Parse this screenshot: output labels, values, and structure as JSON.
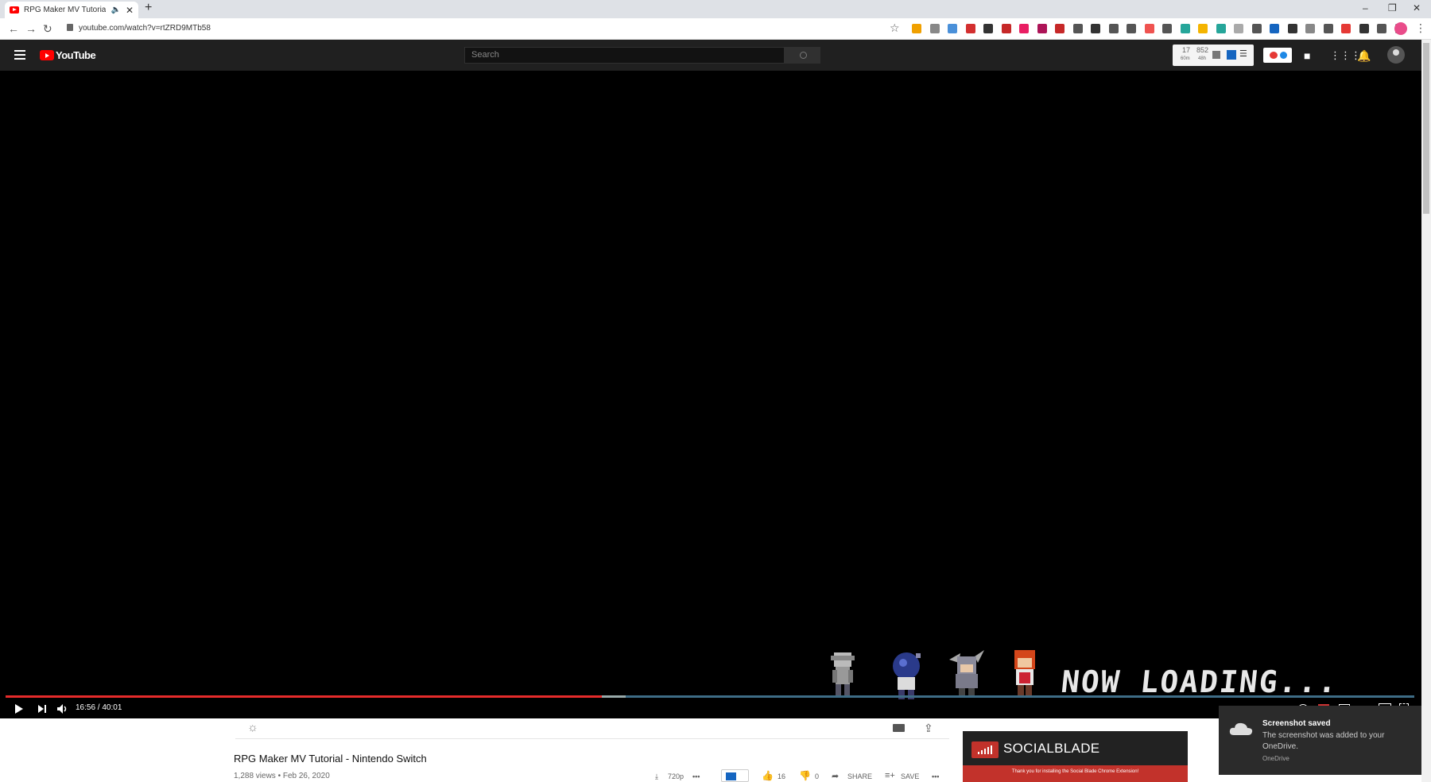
{
  "browser": {
    "tab_title": "RPG Maker MV Tutorial - Ni",
    "url": "youtube.com/watch?v=rtZRD9MTb58",
    "extension_colors": [
      "#f0a000",
      "#888888",
      "#4a90d9",
      "#d32f2f",
      "#333333",
      "#c62828",
      "#e91e63",
      "#ad1457",
      "#c62828",
      "#555555",
      "#333333",
      "#555555",
      "#555555",
      "#ef5350",
      "#555555",
      "#26a69a",
      "#f4b400",
      "#26a69a",
      "#aaaaaa",
      "#555555",
      "#1565c0",
      "#333333",
      "#888888",
      "#555555",
      "#e53935",
      "#333333",
      "#555555",
      "#555555"
    ]
  },
  "header": {
    "logo_text": "YouTube",
    "search_placeholder": "Search",
    "stats": {
      "value1": "17",
      "unit1": "60m",
      "value2": "852",
      "unit2": "48h"
    }
  },
  "video": {
    "time": "16:56 / 40:01",
    "progress_fraction": 0.4232,
    "loading_text": "NOW LOADING..."
  },
  "below": {
    "title": "RPG Maker MV Tutorial - Nintendo Switch",
    "meta": "1,288 views • Feb 26, 2020",
    "quality": "720p",
    "likes": "16",
    "dislikes": "0",
    "share": "SHARE",
    "save": "SAVE"
  },
  "socialblade": {
    "name": "SOCIALBLADE",
    "banner": "Thank you for installing the Social Blade Chrome Extension!"
  },
  "toast": {
    "title": "Screenshot saved",
    "body": "The screenshot was added to your OneDrive.",
    "source": "OneDrive"
  }
}
